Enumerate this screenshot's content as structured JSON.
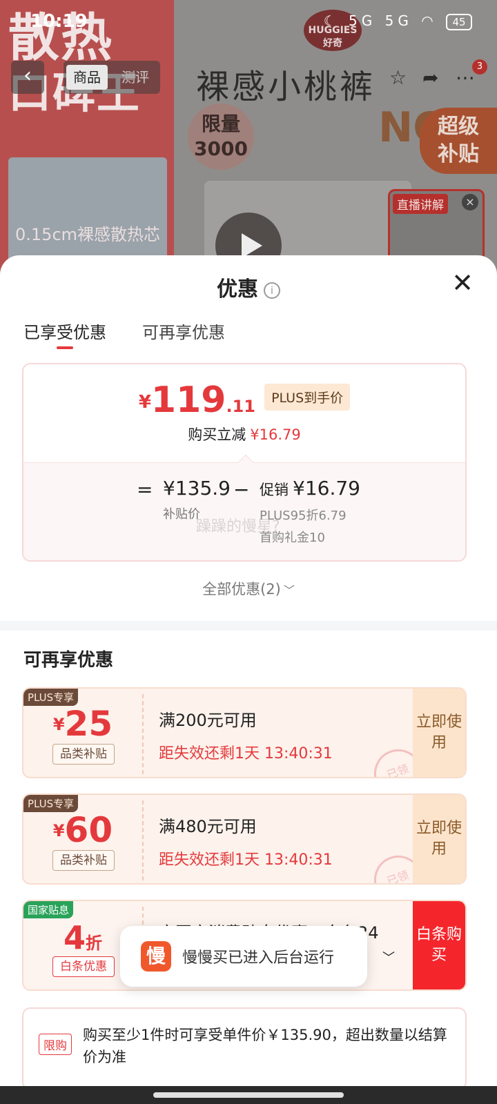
{
  "status_bar": {
    "time": "10:19",
    "signal_1": "5G",
    "signal_2": "5G",
    "battery": "45"
  },
  "background": {
    "left_banner_line1": "散热",
    "left_banner_line2": "口碑王",
    "left_banner_sub": "0.15cm裸感散热芯",
    "product_title": "裸感小桃裤",
    "limited_badge_line1": "限量",
    "limited_badge_line2": "3000",
    "no_text": "NO",
    "super_subsidy_line1": "超级",
    "super_subsidy_line2": "补贴",
    "live_label": "直播讲解",
    "brand_logo": "HUGGIES 好奇"
  },
  "nav": {
    "tab_product": "商品",
    "tab_review": "测评",
    "notification_count": "3"
  },
  "sheet": {
    "title": "优惠",
    "tabs": [
      "已享受优惠",
      "可再享优惠"
    ],
    "price": {
      "currency": "¥",
      "integer": "119",
      "decimal": ".11",
      "plus_label": "PLUS到手价",
      "reduce_label": "购买立减",
      "reduce_value": "¥16.79",
      "equals": "=",
      "base_price": "¥135.9",
      "base_label": "补贴价",
      "minus": "−",
      "promo_label": "促销",
      "promo_value": "¥16.79",
      "promo_sub1": "PLUS95折6.79",
      "promo_sub2": "首购礼金10",
      "watermark": "躁躁的慢星?"
    },
    "all_promos": "全部优惠(2)",
    "section_title": "可再享优惠",
    "coupons": [
      {
        "ribbon": "PLUS专享",
        "currency": "¥",
        "amount": "25",
        "kind": "品类补贴",
        "condition": "满200元可用",
        "expiry": "距失效还剩1天 13:40:31",
        "stamp": "已领",
        "action": "立即使用"
      },
      {
        "ribbon": "PLUS专享",
        "currency": "¥",
        "amount": "60",
        "kind": "品类补贴",
        "condition": "满480元可用",
        "expiry": "距失效还剩1天 13:40:31",
        "stamp": "已领",
        "action": "立即使用"
      },
      {
        "ribbon": "国家贴息",
        "amount": "4",
        "unit": "折",
        "kind": "白条优惠",
        "condition": "享国家消费贴息优惠，白条24",
        "action": "白条购买"
      }
    ],
    "limit": {
      "tag": "限购",
      "text": "购买至少1件时可享受单件价￥135.90，超出数量以结算价为准"
    }
  },
  "toast": {
    "app_icon_char": "慢",
    "message": "慢慢买已进入后台运行"
  },
  "colors": {
    "accent_red": "#e4393c",
    "coupon_bg": "#fdf2ec",
    "plus_ribbon": "#6b4a3a",
    "green_ribbon": "#2aa35a"
  }
}
